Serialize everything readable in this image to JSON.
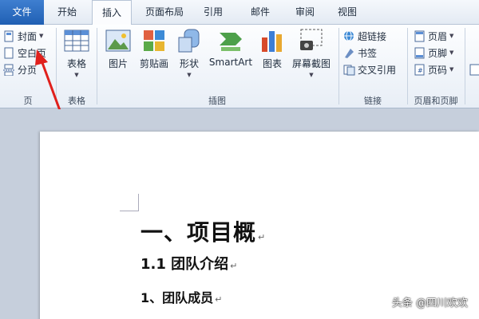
{
  "tabs": [
    {
      "id": "file",
      "label": "文件"
    },
    {
      "id": "home",
      "label": "开始"
    },
    {
      "id": "insert",
      "label": "插入"
    },
    {
      "id": "layout",
      "label": "页面布局"
    },
    {
      "id": "ref",
      "label": "引用"
    },
    {
      "id": "mail",
      "label": "邮件"
    },
    {
      "id": "review",
      "label": "审阅"
    },
    {
      "id": "view",
      "label": "视图"
    }
  ],
  "ribbon": {
    "pages_group": {
      "label": "页",
      "cover": "封面",
      "blank": "空白页",
      "break": "分页"
    },
    "table_group": {
      "label": "表格",
      "table": "表格"
    },
    "illustrations_group": {
      "label": "插图",
      "picture": "图片",
      "clipart": "剪贴画",
      "shapes": "形状",
      "smartart": "SmartArt",
      "chart": "图表",
      "screenshot": "屏幕截图"
    },
    "links_group": {
      "label": "链接",
      "hyperlink": "超链接",
      "bookmark": "书签",
      "crossref": "交叉引用"
    },
    "headerfooter_group": {
      "label": "页眉和页脚",
      "header": "页眉",
      "footer": "页脚",
      "pagenum": "页码"
    }
  },
  "document": {
    "heading1": "一、项目概",
    "heading2": "1.1 团队介绍",
    "heading3": "1、团队成员",
    "para_mark": "↵"
  },
  "watermark": "头条 @四川欢欢",
  "colors": {
    "file_tab": "#2a6cc4",
    "ribbon_bg": "#eef3f9",
    "doc_bg": "#c6cfdc",
    "arrow": "#e0201c"
  }
}
